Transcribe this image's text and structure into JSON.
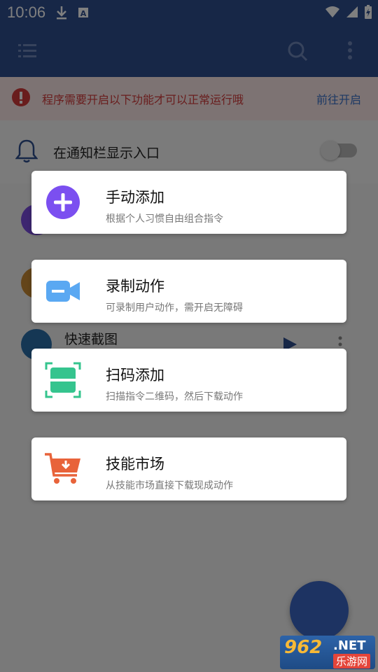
{
  "status_bar": {
    "time": "10:06",
    "icons": [
      "download-icon",
      "a-badge-icon",
      "wifi-icon",
      "signal-icon",
      "battery-charging-icon"
    ]
  },
  "toolbar": {
    "menu_icon": "list-menu-icon",
    "search_icon": "search-icon",
    "more_icon": "more-vertical-icon"
  },
  "warning": {
    "text": "程序需要开启以下功能才可以正常运行哦",
    "link": "前往开启",
    "color": "#d23a3a",
    "link_color": "#3b73c8"
  },
  "notify_row": {
    "label": "在通知栏显示入口",
    "toggle_on": false
  },
  "list": {
    "items": [
      {
        "title": ""
      },
      {
        "title": ""
      },
      {
        "title": "快速截图"
      }
    ]
  },
  "menu": {
    "options": [
      {
        "title": "手动添加",
        "subtitle": "根据个人习惯自由组合指令",
        "icon": "plus-circle-icon",
        "color": "#7b4ff0"
      },
      {
        "title": "录制动作",
        "subtitle": "可录制用户动作，需开启无障碍",
        "icon": "video-camera-icon",
        "color": "#5aa8f2"
      },
      {
        "title": "扫码添加",
        "subtitle": "扫描指令二维码，然后下载动作",
        "icon": "scan-icon",
        "color": "#35c48e"
      },
      {
        "title": "技能市场",
        "subtitle": "从技能市场直接下载现成动作",
        "icon": "shopping-cart-icon",
        "color": "#e8633a"
      }
    ]
  },
  "watermark": {
    "logo": "962",
    "net": ".NET",
    "cn": "乐游网"
  },
  "colors": {
    "primary": "#2f4f8f",
    "overlay": "rgba(0,0,0,0.5)"
  }
}
